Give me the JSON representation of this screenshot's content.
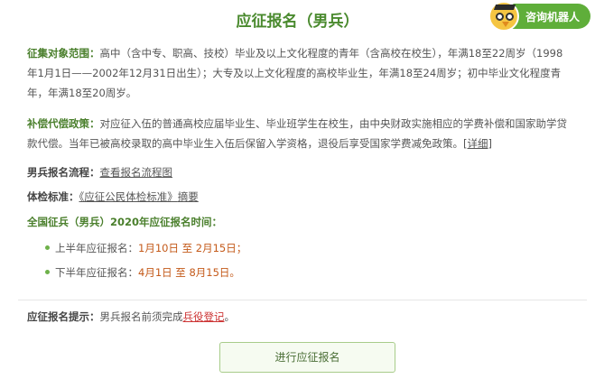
{
  "title": "应征报名（男兵）",
  "robot": {
    "label": "咨询机器人",
    "icon": "owl-robot-icon",
    "color": "#5fae3a"
  },
  "target": {
    "label": "征集对象范围：",
    "text": "高中（含中专、职高、技校）毕业及以上文化程度的青年（含高校在校生），年满18至22周岁（1998年1月1日——2002年12月31日出生）；大专及以上文化程度的高校毕业生，年满18至24周岁；初中毕业文化程度青年，年满18至20周岁。"
  },
  "compensation": {
    "label": "补偿代偿政策：",
    "text": "对应征入伍的普通高校应届毕业生、毕业班学生在校生，由中央财政实施相应的学费补偿和国家助学贷款代偿。当年已被高校录取的高中毕业生入伍后保留入学资格，退役后享受国家学费减免政策。",
    "detail_link": "[详细]"
  },
  "process": {
    "label": "男兵报名流程：",
    "link": "查看报名流程图"
  },
  "physical": {
    "label": "体检标准：",
    "link": "《应征公民体检标准》",
    "suffix": "摘要"
  },
  "schedule": {
    "heading": "全国征兵（男兵）2020年应征报名时间：",
    "first_half": {
      "label": "上半年应征报名：",
      "date": "1月10日 至 2月15日；"
    },
    "second_half": {
      "label": "下半年应征报名：",
      "date": "4月1日 至 8月15日。"
    }
  },
  "tip": {
    "label": "应征报名提示：",
    "text_before": "男兵报名前须完成",
    "link": "兵役登记",
    "text_after": "。"
  },
  "button": {
    "label": "进行应征报名"
  },
  "colors": {
    "title_green": "#4a8a2e",
    "date_orange": "#c45a1a",
    "link_red": "#cc3333"
  }
}
